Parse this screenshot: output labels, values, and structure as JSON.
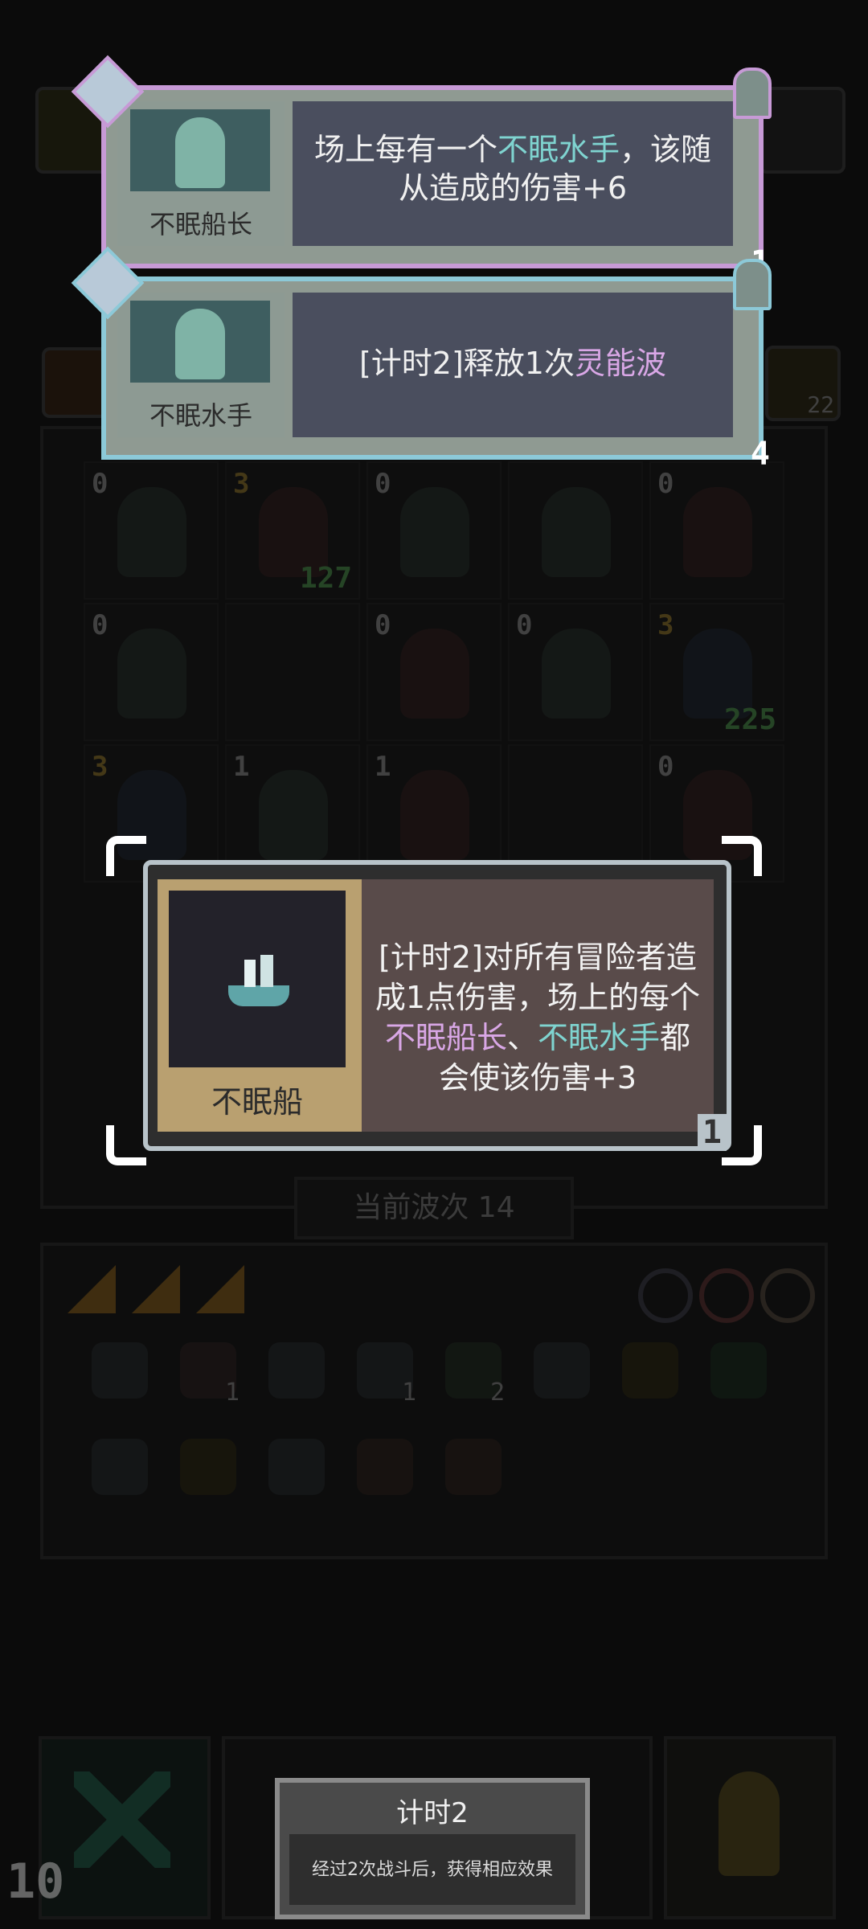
{
  "cards": [
    {
      "name": "不眠船长",
      "desc_parts": [
        "场上每有一个",
        "不眠水手",
        "，该随从造成的伤害+6"
      ],
      "count": "1"
    },
    {
      "name": "不眠水手",
      "desc_parts": [
        "[计时2]释放1次",
        "灵能波"
      ],
      "count": "4"
    }
  ],
  "main_card": {
    "name": "不眠船",
    "desc_parts": [
      "[计时2]对所有冒险者造成1点伤害，场上的每个",
      "不眠船长",
      "、",
      "不眠水手",
      "都会使该伤害+3"
    ],
    "count": "1"
  },
  "board": {
    "slots": [
      {
        "level": "0",
        "hp": ""
      },
      {
        "level": "3",
        "hp": "127"
      },
      {
        "level": "0",
        "hp": ""
      },
      {
        "level": "",
        "hp": ""
      },
      {
        "level": "0",
        "hp": ""
      },
      {
        "level": "0",
        "hp": ""
      },
      {
        "level": "",
        "hp": ""
      },
      {
        "level": "0",
        "hp": ""
      },
      {
        "level": "0",
        "hp": ""
      },
      {
        "level": "3",
        "hp": "225"
      },
      {
        "level": "3",
        "hp": ""
      },
      {
        "level": "1",
        "hp": ""
      },
      {
        "level": "1",
        "hp": ""
      },
      {
        "level": "",
        "hp": ""
      },
      {
        "level": "0",
        "hp": ""
      }
    ],
    "wave_label": "当前波次 14"
  },
  "side_badge": "22",
  "inventory": {
    "badges": [
      "1",
      "1",
      "2"
    ]
  },
  "bottom": {
    "left_number": "10"
  },
  "tooltip": {
    "title": "计时2",
    "text": "经过2次战斗后，获得相应效果"
  },
  "colors": {
    "captain_border": "#c79ad6",
    "sailor_border": "#8cc9d8",
    "main_border": "#b8c3c9",
    "gold": "#b9a070"
  }
}
